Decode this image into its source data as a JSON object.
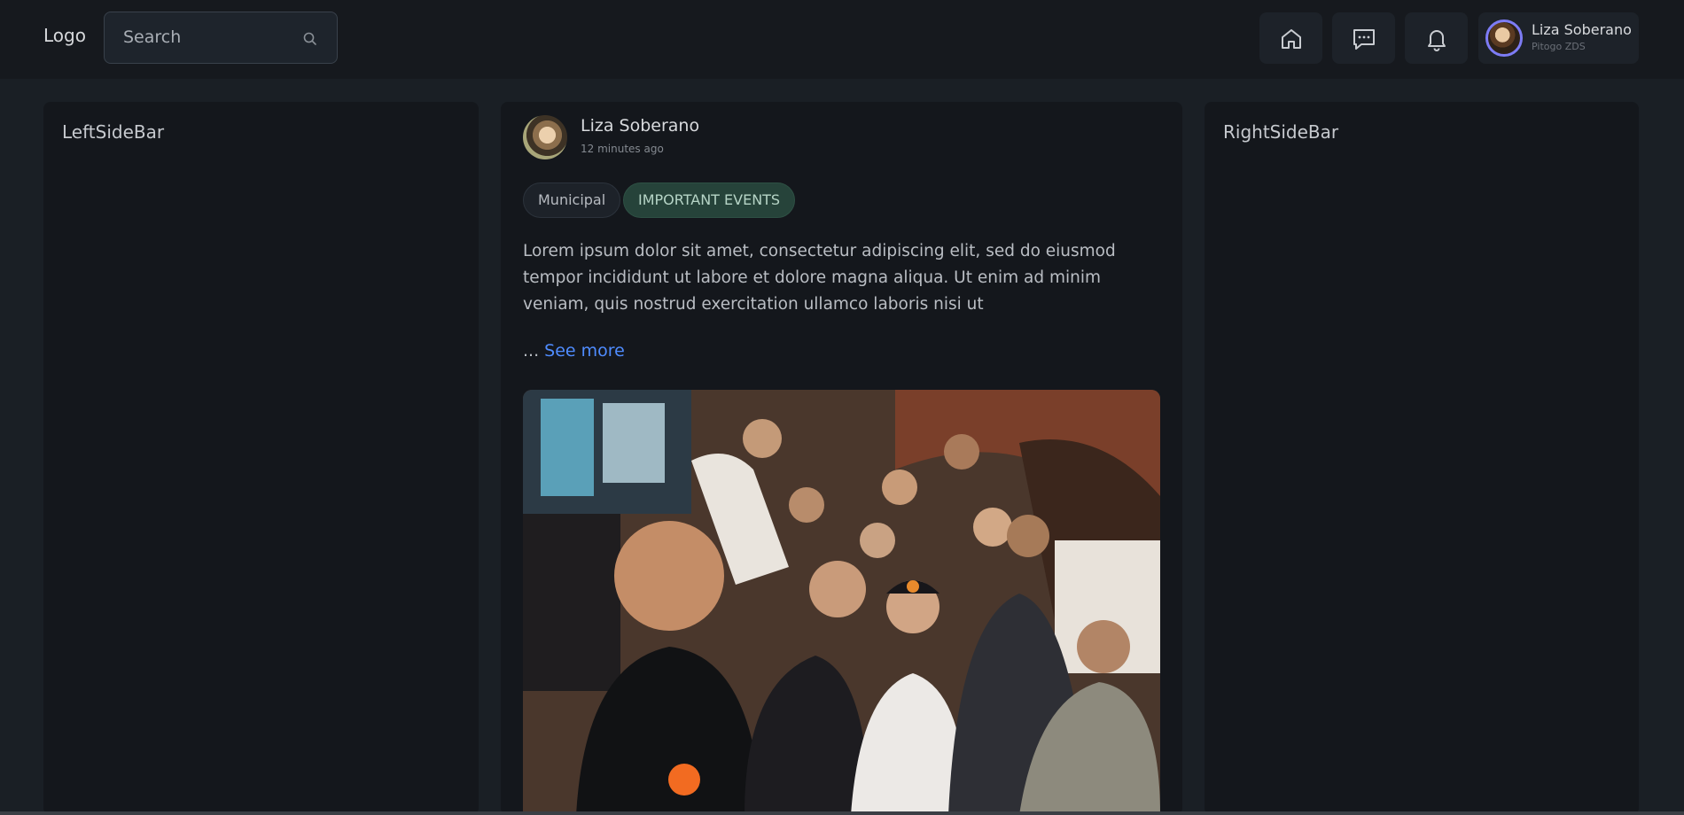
{
  "topbar": {
    "logo": "Logo",
    "search": {
      "placeholder": "Search"
    },
    "nav": {
      "home_icon": "home-icon",
      "messages_icon": "chat-icon",
      "notifications_icon": "bell-icon"
    },
    "profile": {
      "name": "Liza Soberano",
      "subtitle": "Pitogo ZDS"
    }
  },
  "left_sidebar": {
    "title": "LeftSideBar"
  },
  "right_sidebar": {
    "title": "RightSideBar"
  },
  "post": {
    "author": "Liza Soberano",
    "time": "12 minutes ago",
    "tags": [
      "Municipal",
      "IMPORTANT EVENTS"
    ],
    "body": "Lorem ipsum dolor sit amet, consectetur adipiscing elit, sed do eiusmod tempor incididunt ut labore et dolore magna aliqua. Ut enim ad minim veniam, quis nostrud exercitation ullamco laboris nisi ut",
    "ellipsis": "...",
    "see_more": "See more"
  },
  "colors": {
    "background": "#1a1f25",
    "topbar": "#16191e",
    "panel": "#14171c",
    "accent_link": "#4f8cff",
    "tag_important": "#26433a",
    "avatar_ring": "#7d7cf5"
  }
}
